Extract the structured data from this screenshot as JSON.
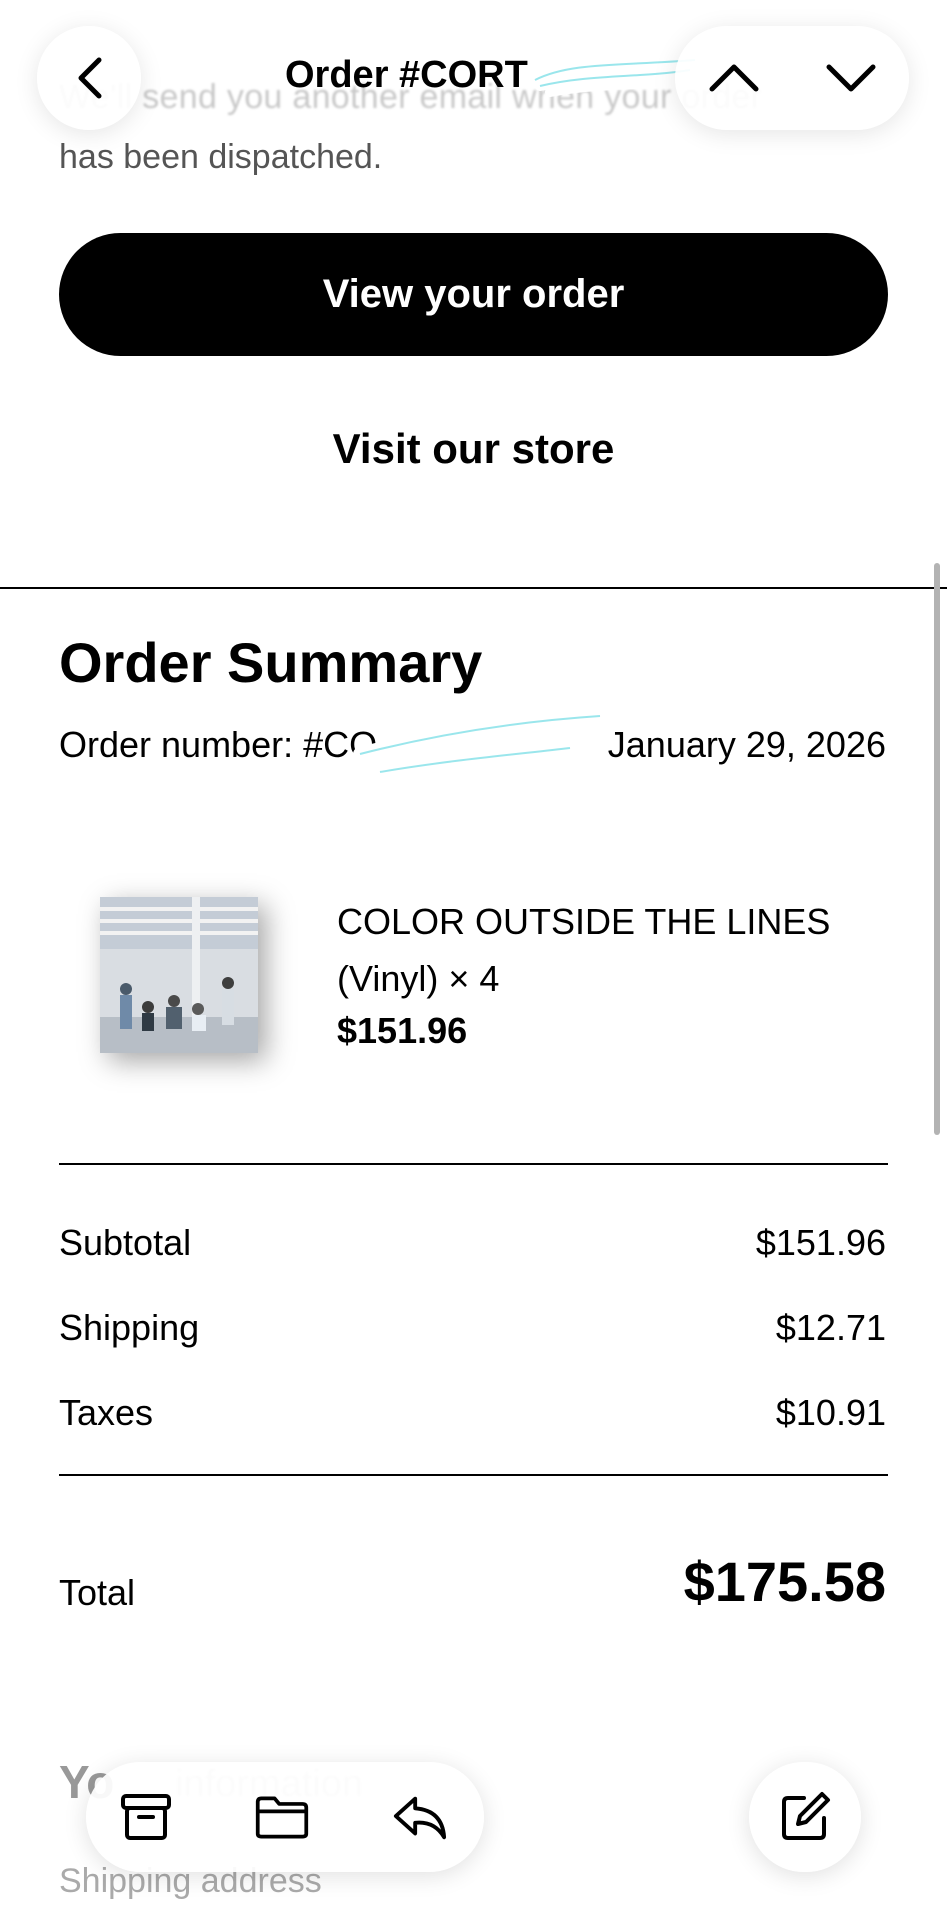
{
  "intro": {
    "line1": "We'll send you another email when your order",
    "line2": "has been dispatched."
  },
  "nav": {
    "title": "Order #CORT",
    "back_icon": "chevron-left-icon",
    "prev_icon": "chevron-up-icon",
    "next_icon": "chevron-down-icon"
  },
  "actions": {
    "view_order": "View your order",
    "visit_store": "Visit our store"
  },
  "summary": {
    "heading": "Order Summary",
    "order_number": "Order number: #CO",
    "date": "January 29, 2026"
  },
  "item": {
    "name": "COLOR OUTSIDE THE LINES (Vinyl) × 4",
    "price": "$151.96"
  },
  "totals": {
    "subtotal_label": "Subtotal",
    "subtotal": "$151.96",
    "shipping_label": "Shipping",
    "shipping": "$12.71",
    "taxes_label": "Taxes",
    "taxes": "$10.91",
    "total_label": "Total",
    "total": "$175.58"
  },
  "footer": {
    "your_heading": "Yo",
    "ghost_text": "information",
    "shipping_address": "Shipping address"
  },
  "toolbar": {
    "archive_icon": "archive-icon",
    "folder_icon": "folder-icon",
    "reply_icon": "reply-icon",
    "compose_icon": "compose-icon"
  },
  "colors": {
    "accent": "#000000",
    "redaction": "#8fe3ea"
  }
}
